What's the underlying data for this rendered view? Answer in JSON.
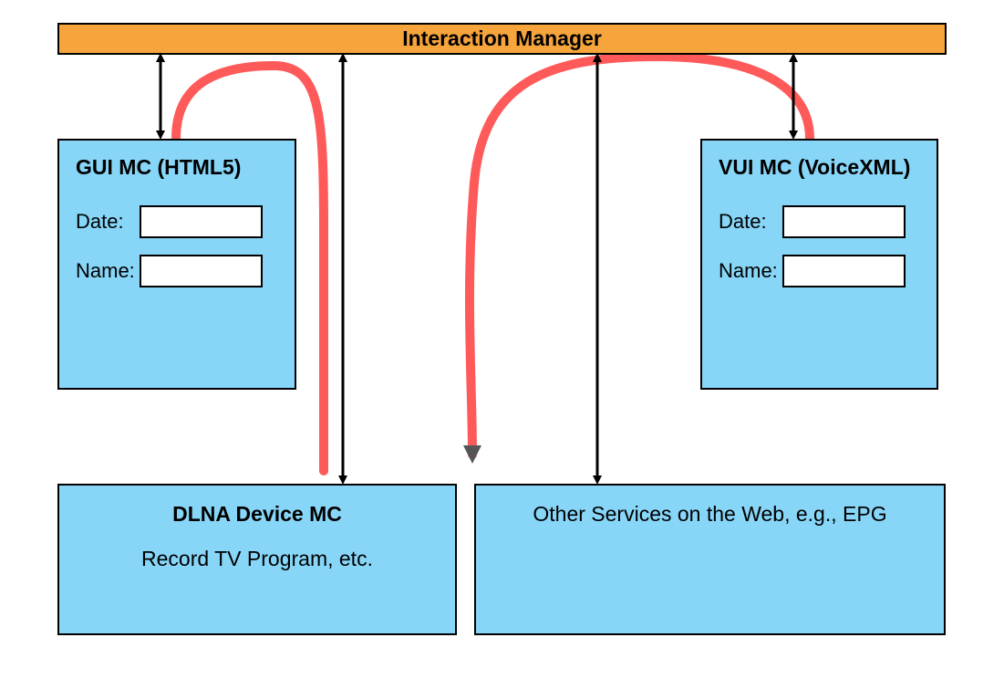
{
  "interaction_manager": {
    "title": "Interaction Manager"
  },
  "gui_mc": {
    "title": "GUI MC (HTML5)",
    "fields": {
      "date_label": "Date:",
      "name_label": "Name:"
    }
  },
  "vui_mc": {
    "title": "VUI MC (VoiceXML)",
    "fields": {
      "date_label": "Date:",
      "name_label": "Name:"
    }
  },
  "dlna": {
    "title": "DLNA Device MC",
    "subtitle": "Record TV Program, etc."
  },
  "other_services": {
    "title": "Other Services on the Web, e.g., EPG"
  }
}
